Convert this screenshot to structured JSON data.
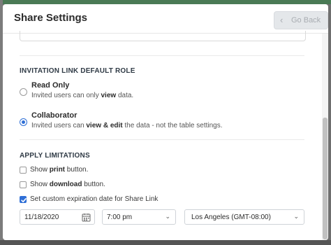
{
  "modal": {
    "title": "Share Settings",
    "go_back_label": "Go Back"
  },
  "invitation": {
    "heading": "INVITATION LINK DEFAULT ROLE",
    "options": [
      {
        "label": "Read Only",
        "desc_pre": "Invited users can only ",
        "desc_bold": "view",
        "desc_post": " data.",
        "selected": false
      },
      {
        "label": "Collaborator",
        "desc_pre": "Invited users can ",
        "desc_bold": "view & edit",
        "desc_post": " the data - not the table settings.",
        "selected": true
      }
    ]
  },
  "limitations": {
    "heading": "APPLY LIMITATIONS",
    "items": [
      {
        "pre": "Show ",
        "bold": "print",
        "post": " button.",
        "checked": false
      },
      {
        "pre": "Show ",
        "bold": "download",
        "post": " button.",
        "checked": false
      },
      {
        "pre": "Set custom expiration date for Share Link",
        "bold": "",
        "post": "",
        "checked": true
      }
    ],
    "date_value": "11/18/2020",
    "time_value": "7:00 pm",
    "timezone_value": "Los Angeles (GMT-08:00)"
  },
  "colors": {
    "accent": "#2f6fd6",
    "button_disabled_bg": "#e4e7ea"
  },
  "icons": {
    "go_back": "chevron-left-icon",
    "date": "calendar-icon",
    "dropdown": "chevron-down-icon"
  }
}
